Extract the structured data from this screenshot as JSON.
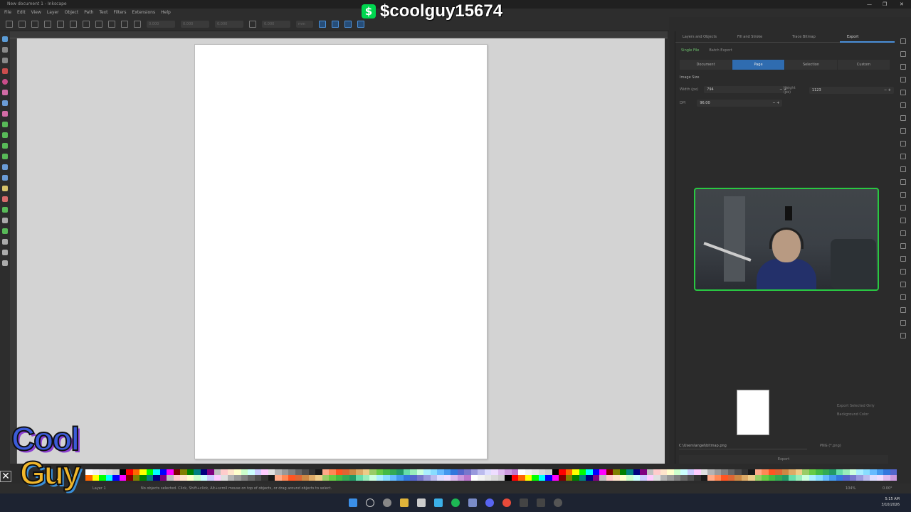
{
  "window": {
    "title": "New document 1 - Inkscape",
    "controls": [
      "—",
      "❐",
      "✕"
    ]
  },
  "menu": [
    "File",
    "Edit",
    "View",
    "Layer",
    "Object",
    "Path",
    "Text",
    "Filters",
    "Extensions",
    "Help"
  ],
  "toolbar": {
    "x": "0.000",
    "y": "0.000",
    "w": "0.000",
    "h": "0.000",
    "unit": "mm"
  },
  "dock": {
    "tabs": [
      "Layers and Objects",
      "Fill and Stroke",
      "Trace Bitmap",
      "Export"
    ],
    "modes": [
      "Single File",
      "Batch Export"
    ],
    "areas": [
      "Document",
      "Page",
      "Selection",
      "Custom"
    ],
    "image_size_label": "Image Size",
    "width_label": "Width (px)",
    "width_value": "794",
    "height_label": "Height (px)",
    "height_value": "1123",
    "dpi_label": "DPI",
    "dpi_value": "96.00",
    "export_selected_only": "Export Selected Only",
    "background_color": "Background Color",
    "filepath": "C:\\Users\\angel\\bitmap.png",
    "format": "PNG (*.png)",
    "export_label": "Export"
  },
  "overlay": {
    "cashtag": "$coolguy15674",
    "cash_icon": "$",
    "logo_line1": "Cool",
    "logo_line2": "Guy"
  },
  "status": {
    "layer": "Layer 1",
    "message": "No objects selected. Click, Shift+click, Alt+scroll mouse on top of objects, or drag around objects to select.",
    "zoom": "104%",
    "rotate": "0.00°"
  },
  "clock": {
    "time": "5:15 AM",
    "date": "3/10/2026"
  },
  "palette": [
    "#ffffff",
    "#f2f2f2",
    "#e6e6e6",
    "#d9d9d9",
    "#cccccc",
    "#000000",
    "#ff0000",
    "#ff6600",
    "#ffff00",
    "#00ff00",
    "#00ffff",
    "#0000ff",
    "#ff00ff",
    "#800000",
    "#808000",
    "#008000",
    "#008080",
    "#000080",
    "#800080",
    "#c0c0c0",
    "#ffcccc",
    "#ffe5cc",
    "#ffffcc",
    "#ccffcc",
    "#ccffff",
    "#ccccff",
    "#ffccff",
    "#e0e0e0",
    "#b3b3b3",
    "#999999",
    "#808080",
    "#666666",
    "#4d4d4d",
    "#333333",
    "#1a1a1a",
    "#ffaa88",
    "#ff8855",
    "#ff5522",
    "#dd6633",
    "#cc8844",
    "#ddaa66",
    "#eecc88",
    "#99cc66",
    "#66cc44",
    "#44bb44",
    "#33aa55",
    "#229966",
    "#66ddaa",
    "#99eebb",
    "#ccffdd",
    "#aaeeff",
    "#88ddff",
    "#66bbff",
    "#4499ee",
    "#3377dd",
    "#5566cc",
    "#7777cc",
    "#9999dd",
    "#bbbbee",
    "#ddddff",
    "#eeddff",
    "#ddbbee",
    "#cc99dd",
    "#bb77cc"
  ]
}
